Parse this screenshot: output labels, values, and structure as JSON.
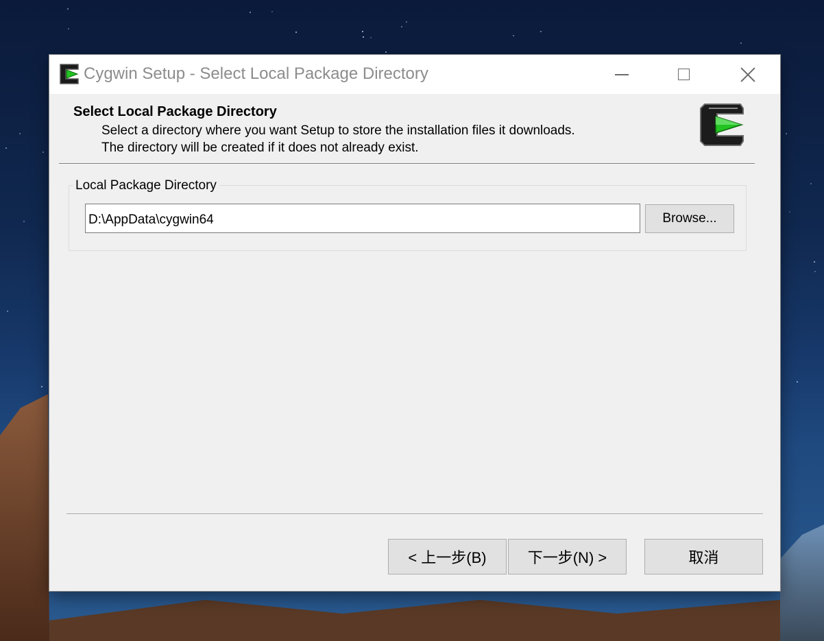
{
  "window": {
    "title": "Cygwin Setup - Select Local Package Directory",
    "controls": {
      "minimize": "minimize-icon",
      "maximize": "maximize-icon",
      "close": "close-icon"
    }
  },
  "header": {
    "heading": "Select Local Package Directory",
    "description": "Select a directory where you want Setup to store the installation files it downloads.  The directory will be created if it does not already exist.",
    "logo": "cygwin-logo-icon"
  },
  "group": {
    "label": "Local Package Directory",
    "directory_value": "D:\\AppData\\cygwin64",
    "browse_label": "Browse..."
  },
  "footer": {
    "back_label": "< 上一步(B)",
    "next_label": "下一步(N) >",
    "cancel_label": "取消"
  },
  "colors": {
    "window_bg": "#f0f0f0",
    "titlebar_bg": "#ffffff",
    "title_text": "#8c8c8c",
    "button_bg": "#e1e1e1",
    "logo_green": "#22c322"
  }
}
